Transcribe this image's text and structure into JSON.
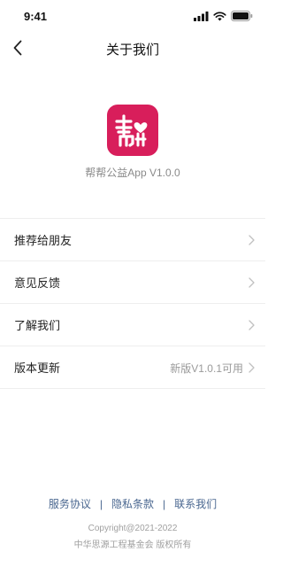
{
  "status_bar": {
    "time": "9:41"
  },
  "nav": {
    "title": "关于我们"
  },
  "app": {
    "version_text": "帮帮公益App V1.0.0",
    "brand_color": "#d81e5b"
  },
  "menu": {
    "items": [
      {
        "label": "推荐给朋友",
        "value": ""
      },
      {
        "label": "意见反馈",
        "value": ""
      },
      {
        "label": "了解我们",
        "value": ""
      },
      {
        "label": "版本更新",
        "value": "新版V1.0.1可用"
      }
    ]
  },
  "footer": {
    "links": [
      "服务协议",
      "隐私条款",
      "联系我们"
    ],
    "separator": "|",
    "copyright": "Copyright@2021-2022",
    "organization": "中华思源工程基金会 版权所有",
    "link_color": "#4a6790"
  }
}
